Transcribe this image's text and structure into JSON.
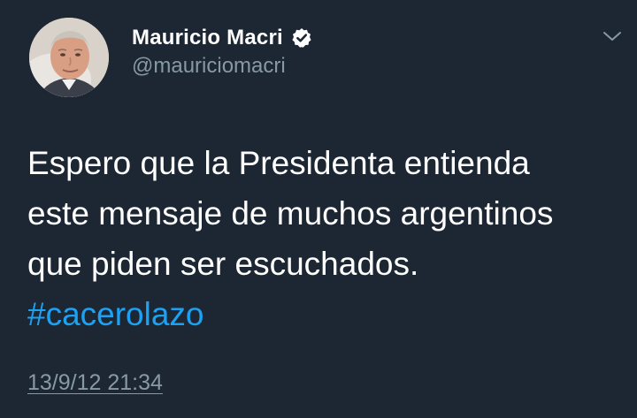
{
  "tweet": {
    "author": {
      "display_name": "Mauricio Macri",
      "handle": "@mauriciomacri",
      "verified": true
    },
    "text_lines": [
      "Espero que la Presidenta entienda",
      "este mensaje de muchos argentinos",
      "que piden ser escuchados."
    ],
    "hashtag": "#cacerolazo",
    "timestamp": "13/9/12 21:34"
  },
  "icons": {
    "verified": "verified-badge-icon",
    "menu": "chevron-down-icon"
  },
  "colors": {
    "background": "#1c2733",
    "text": "#ffffff",
    "secondary_text": "#8899a6",
    "link": "#1da1f2"
  }
}
